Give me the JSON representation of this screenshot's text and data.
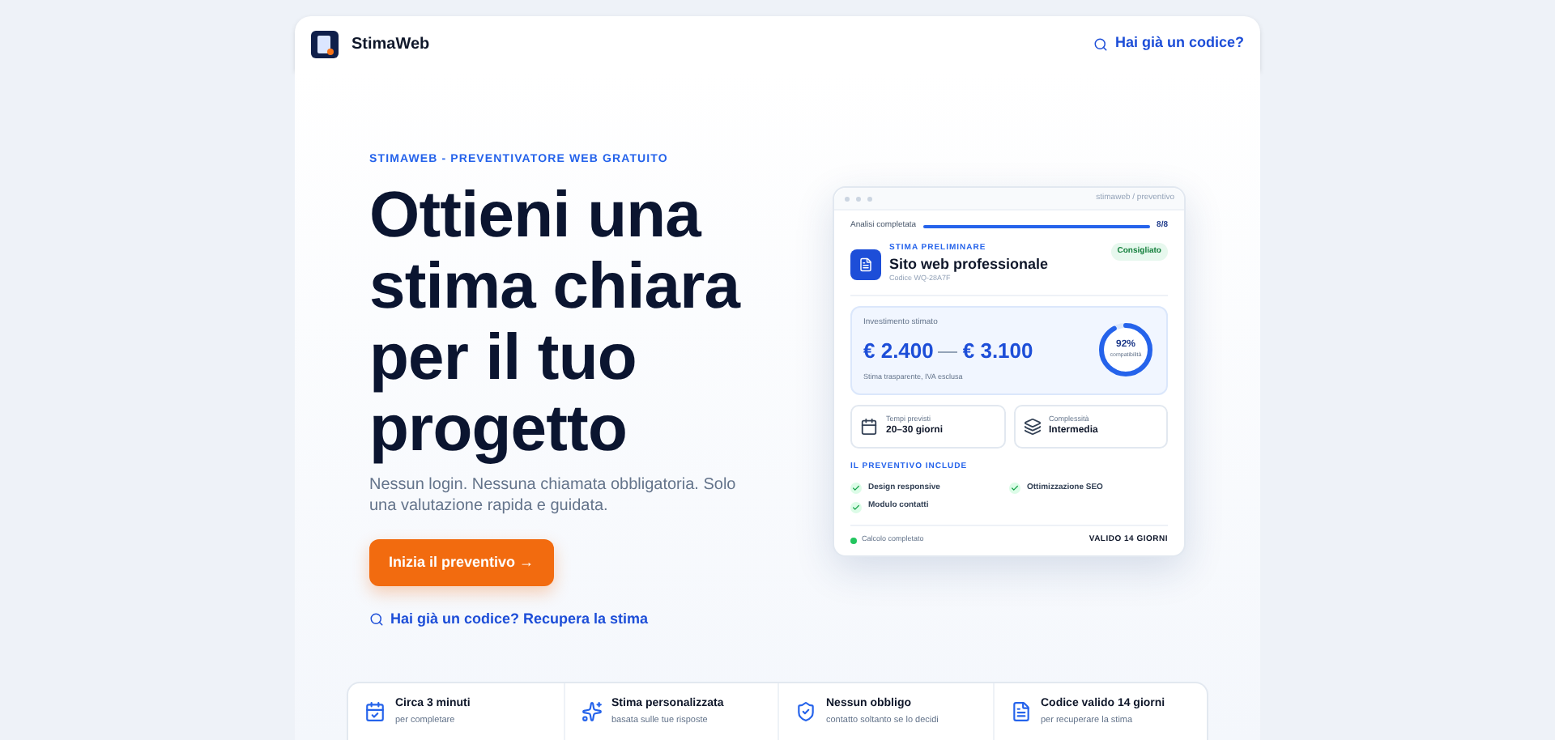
{
  "header": {
    "brand": "StimaWeb",
    "code_link": "Hai già un codice?"
  },
  "hero": {
    "eyebrow": "STIMAWEB - PREVENTIVATORE WEB GRATUITO",
    "title": "Ottieni una stima chiara per il tuo progetto",
    "subtitle": "Nessun login. Nessuna chiamata obbligatoria. Solo una valutazione rapida e guidata.",
    "cta": "Inizia il preventivo →",
    "recover_link": "Hai già un codice? Recupera la stima"
  },
  "preview": {
    "url": "stimaweb / preventivo",
    "progress": {
      "label": "Analisi completata",
      "reading": "8/8",
      "level": 1
    },
    "eyebrow": "STIMA PRELIMINARE",
    "title": "Sito web professionale",
    "code": "Codice WQ-28A7F",
    "badge": "Consigliato",
    "estimate": {
      "label": "Investimento stimato",
      "low": "€ 2.400",
      "high": "€ 3.100",
      "note": "Stima trasparente, IVA esclusa",
      "gauge": {
        "reading": "92%",
        "caption": "compatibilità"
      }
    },
    "facts": [
      {
        "kind": "calendar",
        "label": "Tempi previsti",
        "value": "20–30 giorni"
      },
      {
        "kind": "layers",
        "label": "Complessità",
        "value": "Intermedia"
      }
    ],
    "includes_title": "IL PREVENTIVO INCLUDE",
    "includes": [
      {
        "label": "Design responsive",
        "checked": true
      },
      {
        "label": "Ottimizzazione SEO",
        "checked": true
      },
      {
        "label": "Modulo contatti",
        "checked": true
      }
    ],
    "status": "Calcolo completato",
    "validity": "VALIDO 14 GIORNI"
  },
  "features": [
    {
      "kind": "calendar",
      "title": "Circa 3 minuti",
      "subtitle": "per completare"
    },
    {
      "kind": "sparkle",
      "title": "Stima personalizzata",
      "subtitle": "basata sulle tue risposte"
    },
    {
      "kind": "shield",
      "title": "Nessun obbligo",
      "subtitle": "contatto soltanto se lo decidi"
    },
    {
      "kind": "document",
      "title": "Codice valido 14 giorni",
      "subtitle": "per recuperare la stima"
    }
  ]
}
